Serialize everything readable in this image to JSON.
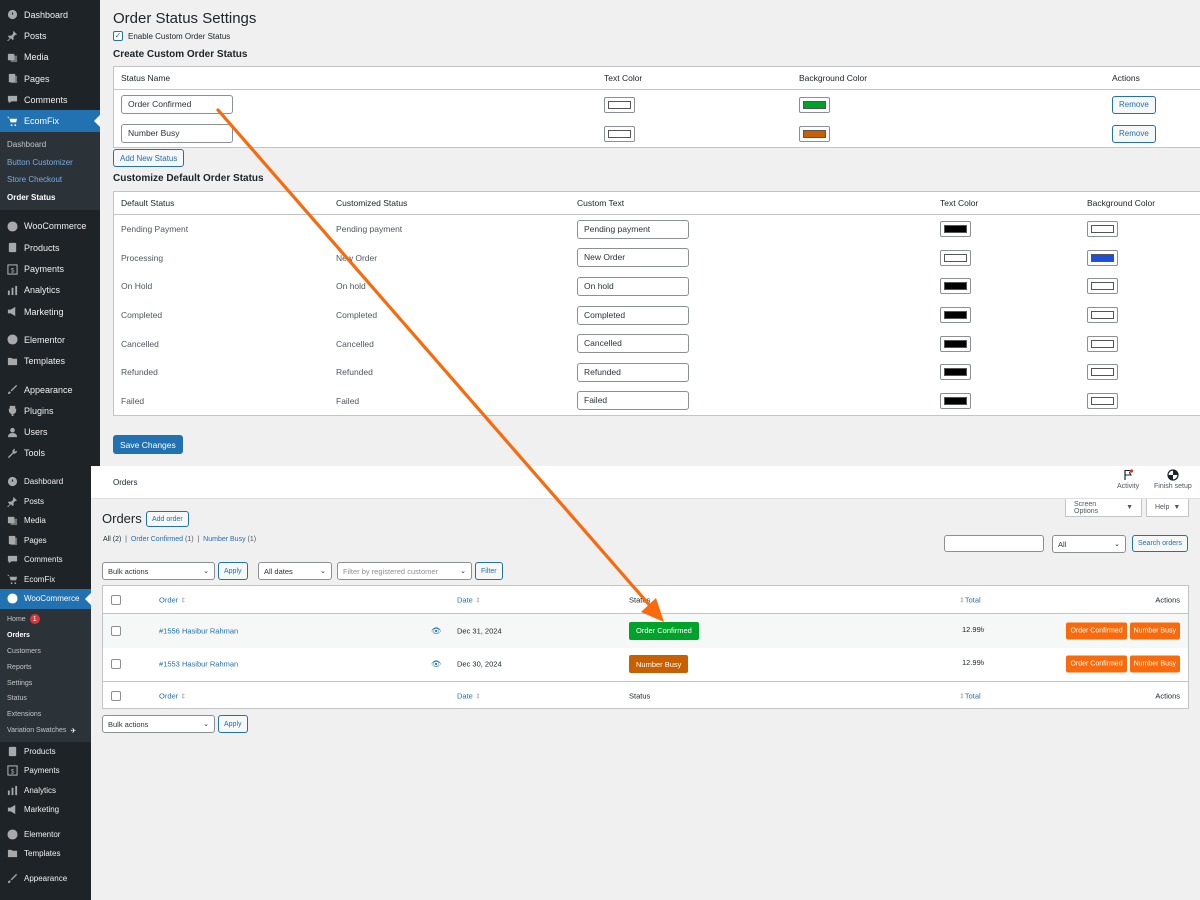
{
  "colors": {
    "accent": "#2271b1",
    "sidebar_bg": "#1d2327",
    "arrow": "#f96a0c",
    "green": "#00a32a",
    "orange_status": "#c85f00",
    "blue": "#1e4fd8"
  },
  "sidebar_top": {
    "items_a": [
      {
        "label": "Dashboard",
        "icon": "dashboard-icon"
      },
      {
        "label": "Posts",
        "icon": "pin-icon"
      },
      {
        "label": "Media",
        "icon": "media-icon"
      },
      {
        "label": "Pages",
        "icon": "pages-icon"
      },
      {
        "label": "Comments",
        "icon": "comments-icon"
      },
      {
        "label": "EcomFix",
        "icon": "cart-icon"
      }
    ],
    "sub": [
      "Dashboard",
      "Button Customizer",
      "Store Checkout",
      "Order Status"
    ],
    "items_b": [
      {
        "label": "WooCommerce",
        "icon": "woo-icon"
      },
      {
        "label": "Products",
        "icon": "products-icon"
      },
      {
        "label": "Payments",
        "icon": "payments-icon"
      },
      {
        "label": "Analytics",
        "icon": "analytics-icon"
      },
      {
        "label": "Marketing",
        "icon": "marketing-icon"
      },
      {
        "label": "Elementor",
        "icon": "elementor-icon"
      },
      {
        "label": "Templates",
        "icon": "templates-icon"
      },
      {
        "label": "Appearance",
        "icon": "appearance-icon"
      },
      {
        "label": "Plugins",
        "icon": "plugins-icon"
      },
      {
        "label": "Users",
        "icon": "users-icon"
      },
      {
        "label": "Tools",
        "icon": "tools-icon"
      }
    ]
  },
  "settings": {
    "title": "Order Status Settings",
    "enable_label": "Enable Custom Order Status",
    "create_heading": "Create Custom Order Status",
    "create_cols": [
      "Status Name",
      "Text Color",
      "Background Color",
      "Actions"
    ],
    "custom_rows": [
      {
        "name": "Order Confirmed",
        "text_color": "#ffffff",
        "bg_color": "#00a32a",
        "action": "Remove"
      },
      {
        "name": "Number Busy",
        "text_color": "#ffffff",
        "bg_color": "#c85f00",
        "action": "Remove"
      }
    ],
    "add_new": "Add New Status",
    "default_heading": "Customize Default Order Status",
    "default_cols": [
      "Default Status",
      "Customized Status",
      "Custom Text",
      "Text Color",
      "Background Color"
    ],
    "default_rows": [
      {
        "default": "Pending Payment",
        "custom": "Pending payment",
        "text": "Pending payment",
        "text_color": "#000000",
        "bg_color": "#ffffff"
      },
      {
        "default": "Processing",
        "custom": "New Order",
        "text": "New Order",
        "text_color": "#ffffff",
        "bg_color": "#1e4fd8"
      },
      {
        "default": "On Hold",
        "custom": "On hold",
        "text": "On hold",
        "text_color": "#000000",
        "bg_color": "#ffffff"
      },
      {
        "default": "Completed",
        "custom": "Completed",
        "text": "Completed",
        "text_color": "#000000",
        "bg_color": "#ffffff"
      },
      {
        "default": "Cancelled",
        "custom": "Cancelled",
        "text": "Cancelled",
        "text_color": "#000000",
        "bg_color": "#ffffff"
      },
      {
        "default": "Refunded",
        "custom": "Refunded",
        "text": "Refunded",
        "text_color": "#000000",
        "bg_color": "#ffffff"
      },
      {
        "default": "Failed",
        "custom": "Failed",
        "text": "Failed",
        "text_color": "#000000",
        "bg_color": "#ffffff"
      }
    ],
    "save": "Save Changes"
  },
  "sidebar_bottom": {
    "items_a": [
      {
        "label": "Dashboard",
        "icon": "dashboard-icon"
      },
      {
        "label": "Posts",
        "icon": "pin-icon"
      },
      {
        "label": "Media",
        "icon": "media-icon"
      },
      {
        "label": "Pages",
        "icon": "pages-icon"
      },
      {
        "label": "Comments",
        "icon": "comments-icon"
      },
      {
        "label": "EcomFix",
        "icon": "cart-icon"
      },
      {
        "label": "WooCommerce",
        "icon": "woo-icon"
      }
    ],
    "sub": [
      "Home",
      "Orders",
      "Customers",
      "Reports",
      "Settings",
      "Status",
      "Extensions",
      "Variation Swatches"
    ],
    "home_badge": "1",
    "items_b": [
      {
        "label": "Products",
        "icon": "products-icon"
      },
      {
        "label": "Payments",
        "icon": "payments-icon"
      },
      {
        "label": "Analytics",
        "icon": "analytics-icon"
      },
      {
        "label": "Marketing",
        "icon": "marketing-icon"
      },
      {
        "label": "Elementor",
        "icon": "elementor-icon"
      },
      {
        "label": "Templates",
        "icon": "templates-icon"
      },
      {
        "label": "Appearance",
        "icon": "appearance-icon"
      }
    ]
  },
  "orders": {
    "header_title": "Orders",
    "activity": "Activity",
    "finish_setup": "Finish setup",
    "screen_options": "Screen Options",
    "help": "Help",
    "title": "Orders",
    "add_order": "Add order",
    "filters": {
      "all": "All",
      "all_count": "(2)",
      "confirmed": "Order Confirmed",
      "confirmed_count": "(1)",
      "busy": "Number Busy",
      "busy_count": "(1)"
    },
    "search_status": "All",
    "search_button": "Search orders",
    "bulk_actions": "Bulk actions",
    "apply": "Apply",
    "all_dates": "All dates",
    "customer_placeholder": "Filter by registered customer",
    "filter": "Filter",
    "columns": {
      "order": "Order",
      "date": "Date",
      "status": "Status",
      "total": "Total",
      "actions": "Actions"
    },
    "rows": [
      {
        "order": "#1556 Hasibur Rahman",
        "date": "Dec 31, 2024",
        "status": "Order Confirmed",
        "status_bg": "#00a32a",
        "total": "12.99৳",
        "actions": [
          "Order Confirmed",
          "Number Busy"
        ]
      },
      {
        "order": "#1553 Hasibur Rahman",
        "date": "Dec 30, 2024",
        "status": "Number Busy",
        "status_bg": "#c85f00",
        "total": "12.99৳",
        "actions": [
          "Order Confirmed",
          "Number Busy"
        ]
      }
    ]
  }
}
